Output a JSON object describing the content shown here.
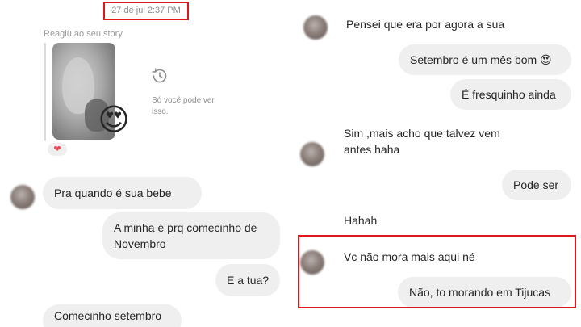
{
  "left": {
    "timestamp": "27 de jul 2:37 PM",
    "story_label": "Reagiu ao seu story",
    "story_reaction_emoji": "😍",
    "story_unavailable": "Só você pode ver isso.",
    "heart_badge": "❤",
    "messages": [
      {
        "side": "in",
        "text": "Pra quando é sua bebe"
      },
      {
        "side": "out",
        "text_line1": "A minha é prq comecinho de",
        "text_line2": "Novembro"
      },
      {
        "side": "out",
        "text": "E a tua?"
      },
      {
        "side": "in",
        "text": "Comecinho setembro"
      }
    ]
  },
  "right": {
    "messages": [
      {
        "side": "in",
        "text": "Pensei que era por agora a sua"
      },
      {
        "side": "out",
        "text": "Setembro é um mês bom 😍"
      },
      {
        "side": "out",
        "text": "É fresquinho ainda"
      },
      {
        "side": "in",
        "text_line1": "Sim ,mais acho que talvez vem",
        "text_line2": "antes haha"
      },
      {
        "side": "out",
        "text": "Pode ser"
      },
      {
        "side": "in",
        "text": "Hahah"
      },
      {
        "side": "in",
        "text": "Vc não mora mais aqui né"
      },
      {
        "side": "out",
        "text": "Não, to morando em Tijucas"
      }
    ]
  },
  "colors": {
    "highlight": "#e0161c",
    "bubble_bg": "#efefef",
    "text": "#262626",
    "muted": "#8e8e8e"
  },
  "icons": [
    "history-icon",
    "heart-icon",
    "heart-eyes-emoji"
  ]
}
